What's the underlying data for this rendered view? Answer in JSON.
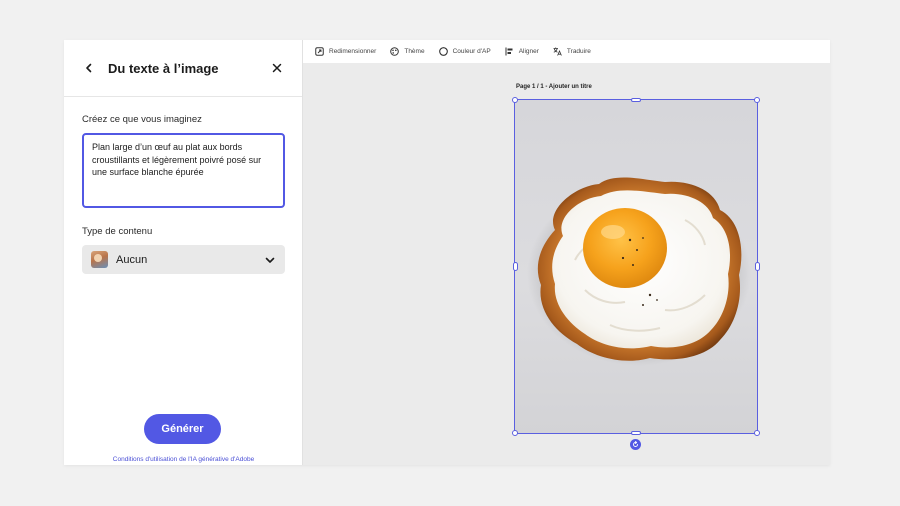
{
  "panel": {
    "title": "Du texte à l’image",
    "prompt_label": "Créez ce que vous imaginez",
    "prompt_value": "Plan large d’un œuf au plat aux bords croustillants et légèrement poivré posé sur une surface blanche épurée",
    "type_label": "Type de contenu",
    "type_value": "Aucun",
    "generate_label": "Générer",
    "terms_link": "Conditions d'utilisation de l'IA générative d'Adobe"
  },
  "toolbar": {
    "items": [
      {
        "label": "Redimensionner",
        "icon": "resize-icon"
      },
      {
        "label": "Thème",
        "icon": "theme-icon"
      },
      {
        "label": "Couleur d'AP",
        "icon": "circle-icon"
      },
      {
        "label": "Aligner",
        "icon": "align-icon"
      },
      {
        "label": "Traduire",
        "icon": "translate-icon"
      }
    ]
  },
  "canvas": {
    "page_label": "Page 1 / 1 - Ajouter un titre"
  },
  "colors": {
    "accent": "#5258e4",
    "background": "#f1f1f1",
    "canvas": "#ebebeb"
  }
}
